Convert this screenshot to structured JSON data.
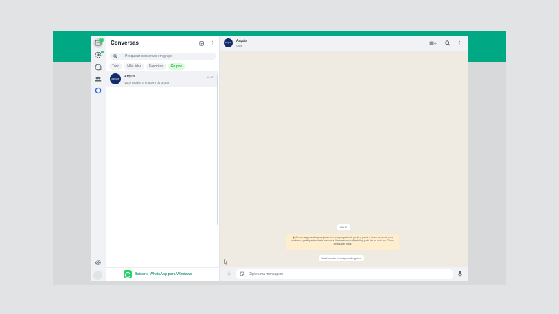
{
  "colors": {
    "accent": "#00a884",
    "chip_active_bg": "#d9fdd3",
    "chip_active_text": "#008069",
    "notice_bg": "#ffeecd"
  },
  "rail": {
    "chats_badge": "3",
    "icons": [
      "chats-icon",
      "status-icon",
      "channels-icon",
      "communities-icon",
      "meta-ai-icon",
      "settings-icon",
      "profile-avatar"
    ]
  },
  "list": {
    "title": "Conversas",
    "search_placeholder": "Pesquisar conversas em grupo",
    "chips": [
      "Tudo",
      "Não lidas",
      "Favoritas",
      "Grupos"
    ],
    "active_chip": "Grupos",
    "chats": [
      {
        "avatar_text": "ARQUIS",
        "name": "Arquis",
        "preview": "Você mudou a imagem do grupo",
        "time": "10:07"
      }
    ],
    "download_label": "Baixar o WhatsApp para Windows"
  },
  "conversation": {
    "avatar_text": "ARQUIS",
    "name": "Arquis",
    "subtitle": "Você",
    "day_label": "HOJE",
    "encryption_notice": "🔒 As mensagens são protegidas com a criptografia de ponta a ponta e ficam somente entre você e os participantes desta conversa. Nem mesmo o WhatsApp pode ler ou ouvi-las. Clique para saber mais.",
    "system_message": "Você mudou a imagem do grupo",
    "composer_placeholder": "Digite uma mensagem"
  }
}
